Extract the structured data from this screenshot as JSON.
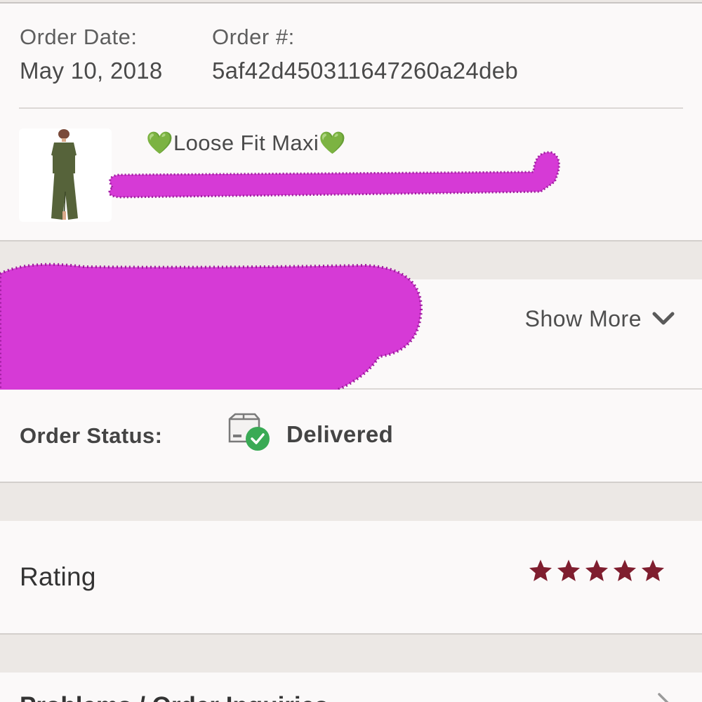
{
  "order": {
    "date_label": "Order Date:",
    "date_value": "May 10, 2018",
    "number_label": "Order #:",
    "number_value": "5af42d450311647260a24deb"
  },
  "item": {
    "title_prefix": "💚",
    "title": "Loose Fit Maxi",
    "title_suffix": "💚"
  },
  "details": {
    "show_more_label": "Show More"
  },
  "status": {
    "label": "Order Status:",
    "value": "Delivered",
    "icon": "package-delivered-icon",
    "check_color": "#3aaa55"
  },
  "rating": {
    "label": "Rating",
    "stars": 5,
    "max_stars": 5,
    "star_color": "#7f1e2f"
  },
  "next_section": {
    "label": "Problems / Order Inquiries"
  },
  "redaction_color": "#d63ad6"
}
